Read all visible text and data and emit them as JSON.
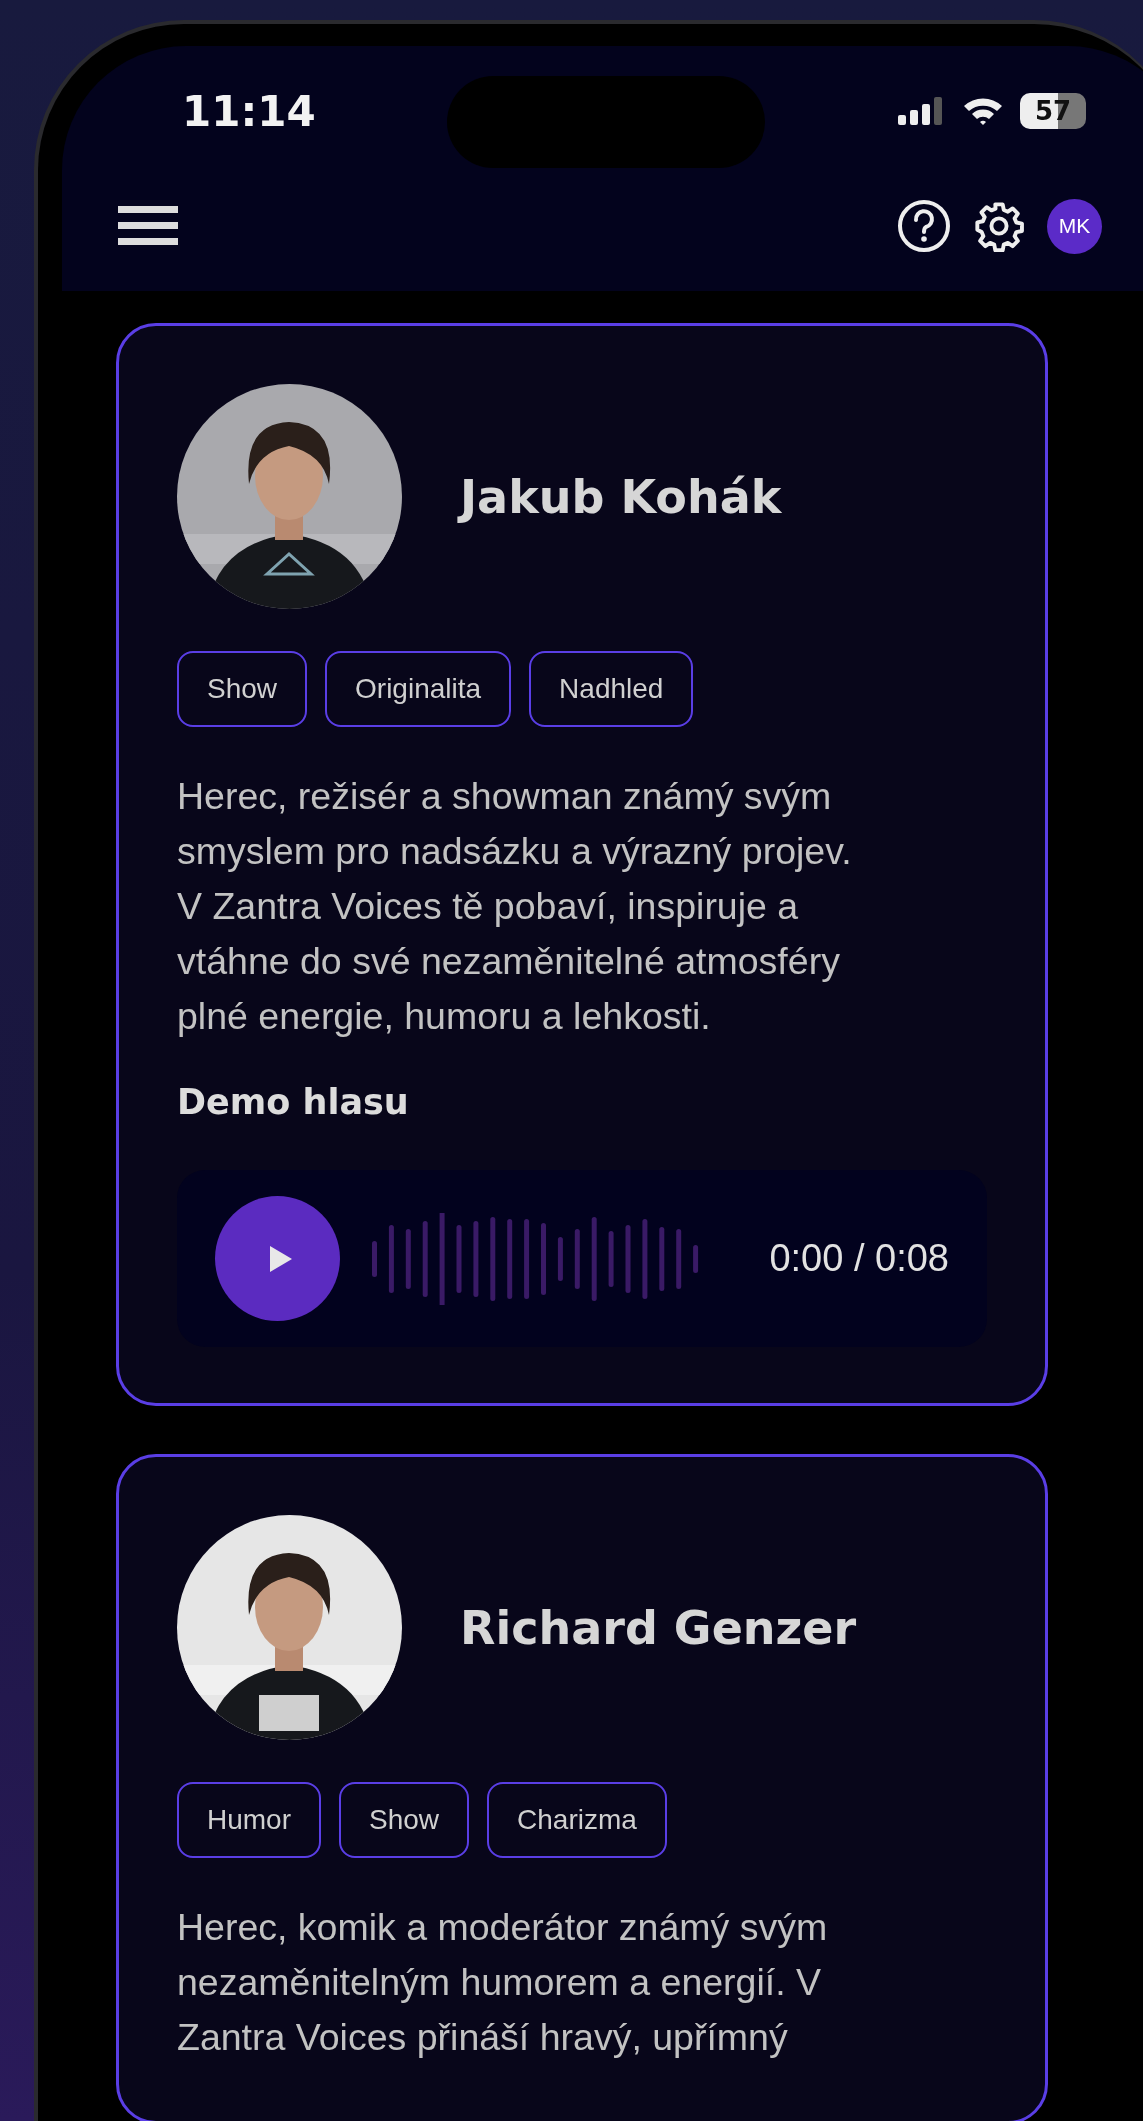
{
  "status_bar": {
    "time": "11:14",
    "battery": "57"
  },
  "header": {
    "avatar_initials": "MK"
  },
  "cards": [
    {
      "name": "Jakub Kohák",
      "tags": [
        "Show",
        "Originalita",
        "Nadhled"
      ],
      "description_lines": [
        "Herec, režisér a showman známý svým",
        "smyslem pro nadsázku a výrazný projev.",
        "V Zantra Voices tě pobaví, inspiruje a",
        "vtáhne do své nezaměnitelné atmosféry",
        "plné energie, humoru a lehkosti."
      ],
      "demo_label": "Demo hlasu",
      "player": {
        "time": "0:00 / 0:08"
      }
    },
    {
      "name": "Richard Genzer",
      "tags": [
        "Humor",
        "Show",
        "Charizma"
      ],
      "description_lines": [
        "Herec, komik a moderátor známý svým",
        "nezaměnitelným humorem a energií. V",
        "Zantra Voices přináší hravý, upřímný"
      ]
    }
  ]
}
